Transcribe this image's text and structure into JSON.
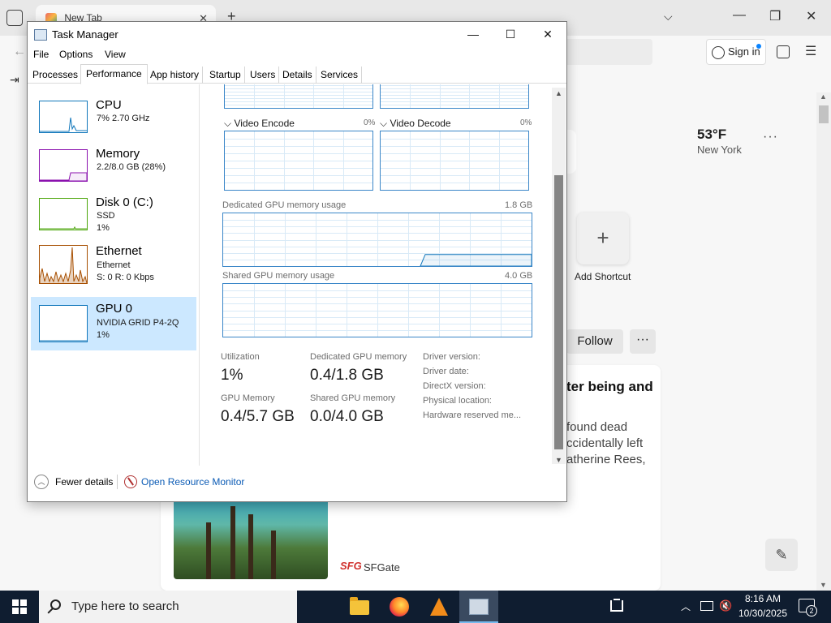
{
  "browser": {
    "tab_title": "New Tab",
    "tab_close": "✕",
    "new_tab": "+",
    "tab_list_icon": "chevron-down-icon",
    "sign_in_label": "Sign in",
    "weather": {
      "temp": "53°F",
      "city": "New York",
      "more": "···"
    },
    "add_shortcut_label": "Add Shortcut",
    "follow_label": "Follow",
    "follow_more": "···",
    "article": {
      "title": "ter being and",
      "snippet": "found dead ccidentally left atherine Rees,",
      "source_logo": "SFG",
      "source_name": "SFGate"
    }
  },
  "task_manager": {
    "title": "Task Manager",
    "menu": [
      "File",
      "Options",
      "View"
    ],
    "tabs": [
      "Processes",
      "Performance",
      "App history",
      "Startup",
      "Users",
      "Details",
      "Services"
    ],
    "active_tab": "Performance",
    "resources": [
      {
        "name": "CPU",
        "line1": "7% 2.70 GHz",
        "line2": "",
        "color": "#1177bb",
        "usage": 0.07
      },
      {
        "name": "Memory",
        "line1": "2.2/8.0 GB (28%)",
        "line2": "",
        "color": "#8b12ae",
        "usage": 0.28
      },
      {
        "name": "Disk 0 (C:)",
        "line1": "SSD",
        "line2": "1%",
        "color": "#4da60c",
        "usage": 0.01
      },
      {
        "name": "Ethernet",
        "line1": "Ethernet",
        "line2": "S: 0 R: 0 Kbps",
        "color": "#a74f01",
        "usage": 0
      },
      {
        "name": "GPU 0",
        "line1": "NVIDIA GRID P4-2Q",
        "line2": "1%",
        "color": "#1177bb",
        "usage": 0.01
      }
    ],
    "selected_resource": "GPU 0",
    "gpu": {
      "engine_left": {
        "label": "Video Encode",
        "percent": "0%"
      },
      "engine_right": {
        "label": "Video Decode",
        "percent": "0%"
      },
      "dedicated_label": "Dedicated GPU memory usage",
      "dedicated_max": "1.8 GB",
      "shared_label": "Shared GPU memory usage",
      "shared_max": "4.0 GB",
      "dedicated_fraction": 0.22,
      "stats": {
        "utilization_label": "Utilization",
        "utilization_value": "1%",
        "dedicated_label": "Dedicated GPU memory",
        "dedicated_value": "0.4/1.8 GB",
        "gpu_memory_label": "GPU Memory",
        "gpu_memory_value": "0.4/5.7 GB",
        "shared_label": "Shared GPU memory",
        "shared_value": "0.0/4.0 GB"
      },
      "info_labels": [
        "Driver version:",
        "Driver date:",
        "DirectX version:",
        "Physical location:",
        "Hardware reserved me..."
      ]
    },
    "footer": {
      "fewer_details": "Fewer details",
      "open_resource_monitor": "Open Resource Monitor"
    },
    "graph_color": "#1177bb"
  },
  "taskbar": {
    "search_placeholder": "Type here to search",
    "time": "8:16 AM",
    "date": "10/30/2025",
    "notification_count": "2",
    "tray_chevron": "︿"
  }
}
